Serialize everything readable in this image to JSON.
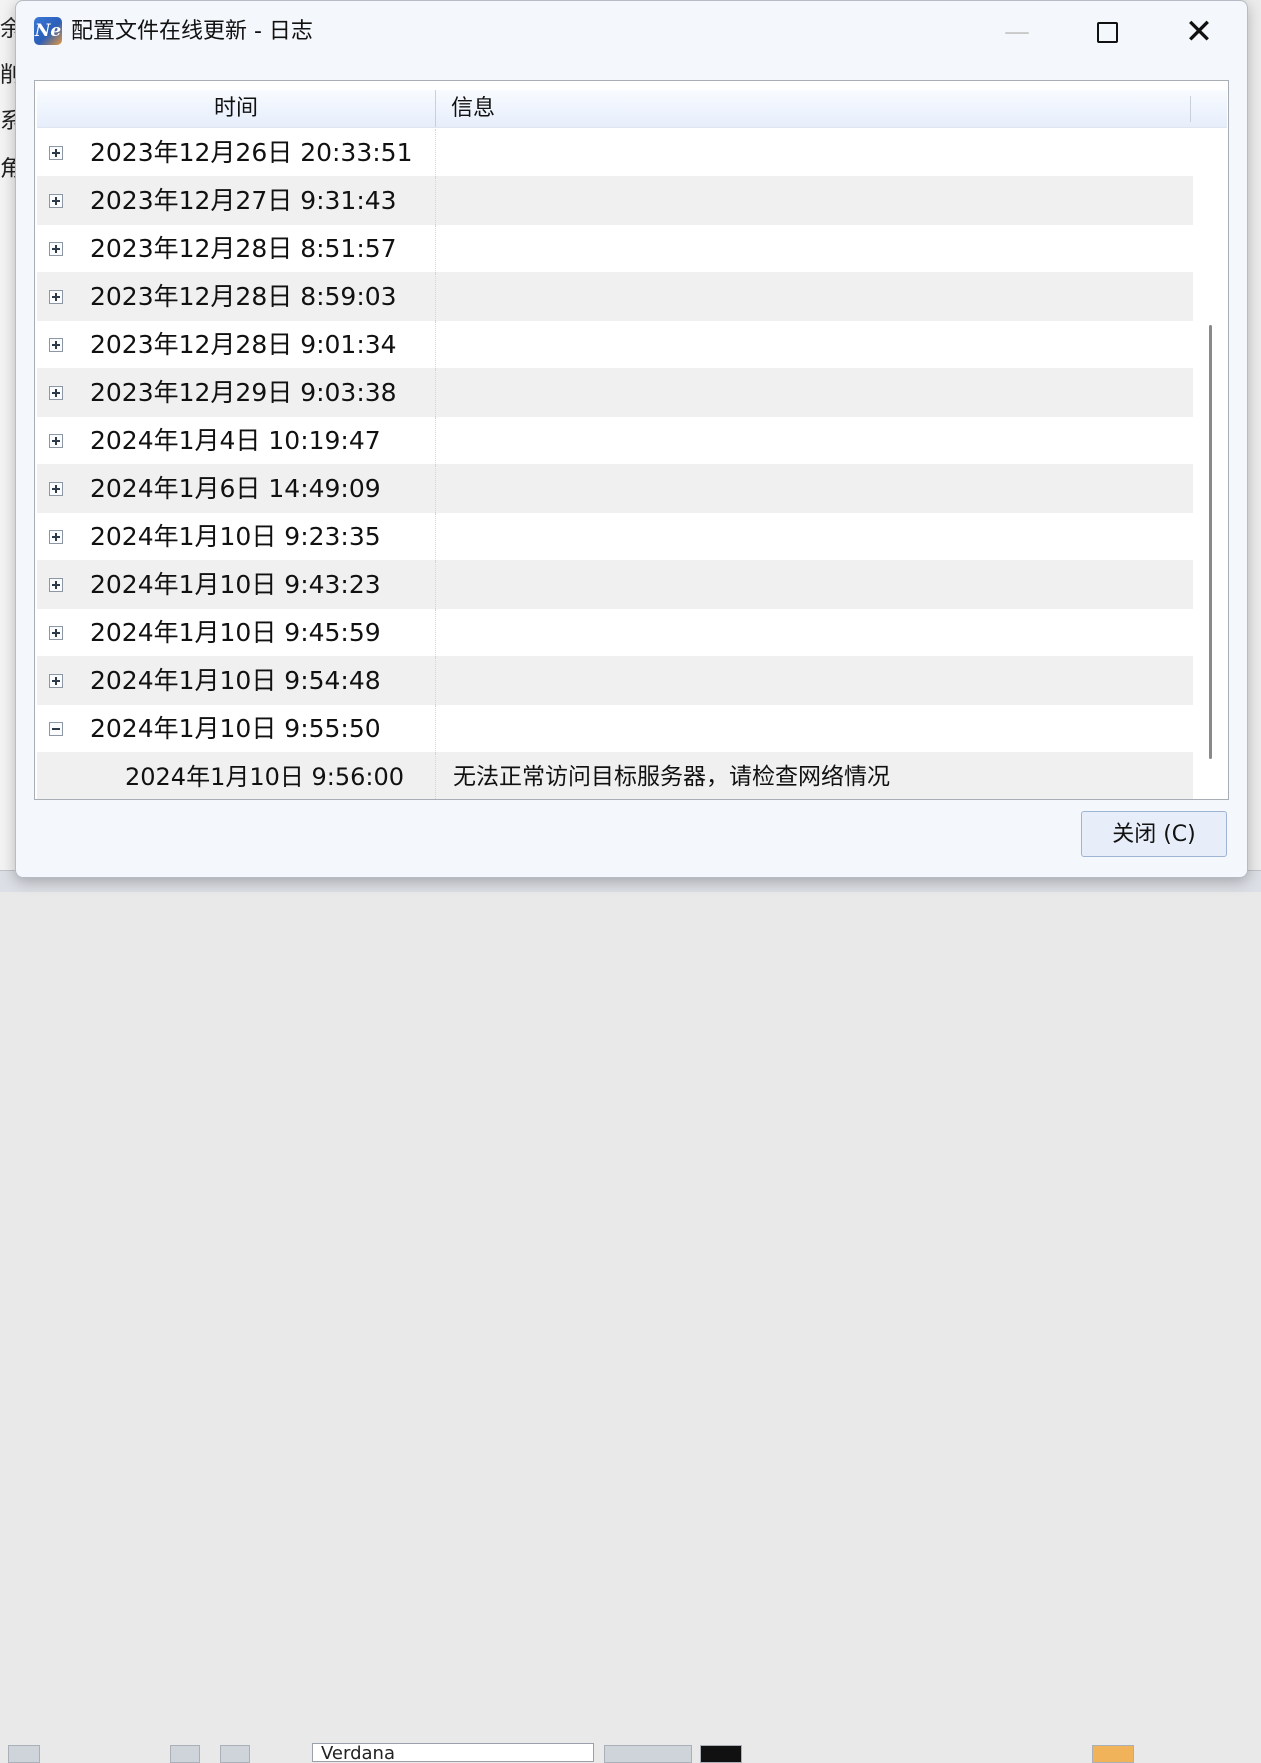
{
  "window": {
    "icon_text": "Ne",
    "title": "配置文件在线更新 - 日志",
    "controls": {
      "minimize": "—",
      "close": "✕"
    }
  },
  "log_table": {
    "columns": [
      "时间",
      "信息"
    ],
    "rows": [
      {
        "time": "2023年12月26日 20:33:51",
        "info": "",
        "expanded": false
      },
      {
        "time": "2023年12月27日 9:31:43",
        "info": "",
        "expanded": false
      },
      {
        "time": "2023年12月28日 8:51:57",
        "info": "",
        "expanded": false
      },
      {
        "time": "2023年12月28日 8:59:03",
        "info": "",
        "expanded": false
      },
      {
        "time": "2023年12月28日 9:01:34",
        "info": "",
        "expanded": false
      },
      {
        "time": "2023年12月29日 9:03:38",
        "info": "",
        "expanded": false
      },
      {
        "time": "2024年1月4日 10:19:47",
        "info": "",
        "expanded": false
      },
      {
        "time": "2024年1月6日 14:49:09",
        "info": "",
        "expanded": false
      },
      {
        "time": "2024年1月10日 9:23:35",
        "info": "",
        "expanded": false
      },
      {
        "time": "2024年1月10日 9:43:23",
        "info": "",
        "expanded": false
      },
      {
        "time": "2024年1月10日 9:45:59",
        "info": "",
        "expanded": false
      },
      {
        "time": "2024年1月10日 9:54:48",
        "info": "",
        "expanded": false
      },
      {
        "time": "2024年1月10日 9:55:50",
        "info": "",
        "expanded": true
      }
    ],
    "child_row": {
      "time": "2024年1月10日 9:56:00",
      "info": "无法正常访问目标服务器，请检查网络情况"
    }
  },
  "footer": {
    "close_button": "关闭 (C)"
  },
  "background": {
    "left_fragments": [
      "余",
      "削",
      "系",
      "角"
    ],
    "font_name": "Verdana"
  }
}
